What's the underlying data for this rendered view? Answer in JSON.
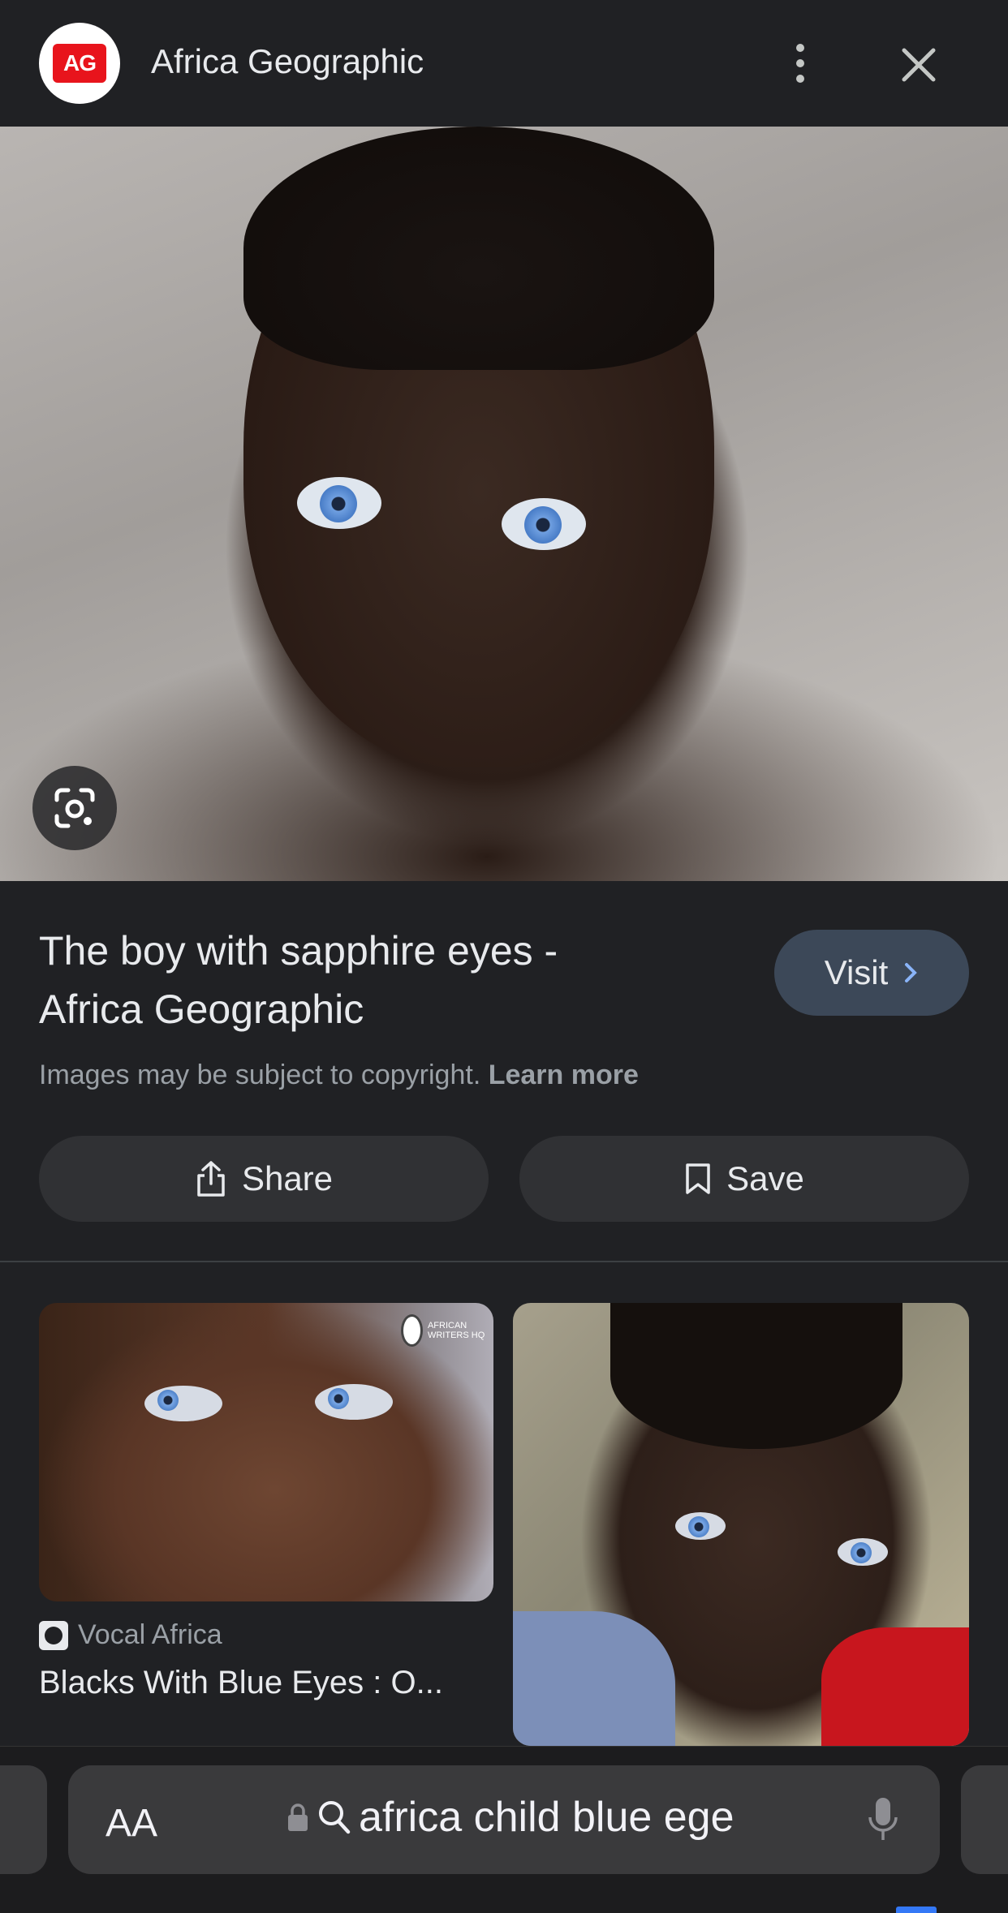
{
  "header": {
    "logo_text": "AG",
    "site_name": "Africa Geographic"
  },
  "result": {
    "title": "The boy with sapphire eyes - Africa Geographic",
    "visit_label": "Visit",
    "copyright_text": "Images may be subject to copyright.",
    "learn_more": "Learn more",
    "share_label": "Share",
    "save_label": "Save"
  },
  "related": [
    {
      "source": "Vocal Africa",
      "title": "Blacks With Blue Eyes : O...",
      "watermark": "AFRICAN WRITERS HQ"
    },
    {
      "source": "",
      "title": ""
    }
  ],
  "browser": {
    "text_size_label": "AA",
    "address_text": "africa child blue ege"
  },
  "icons": {
    "logo": "ag-logo-icon",
    "menu": "more-vert-icon",
    "close": "close-icon",
    "lens": "google-lens-icon",
    "visit": "chevron-right-icon",
    "share": "share-icon",
    "save": "bookmark-icon",
    "lock": "lock-icon",
    "search": "search-icon",
    "mic": "mic-icon"
  },
  "colors": {
    "background": "#202124",
    "accent_red": "#e8141c",
    "visit_button": "#3c4858",
    "pill": "#303134",
    "browser_bar": "#3a3a3c"
  }
}
